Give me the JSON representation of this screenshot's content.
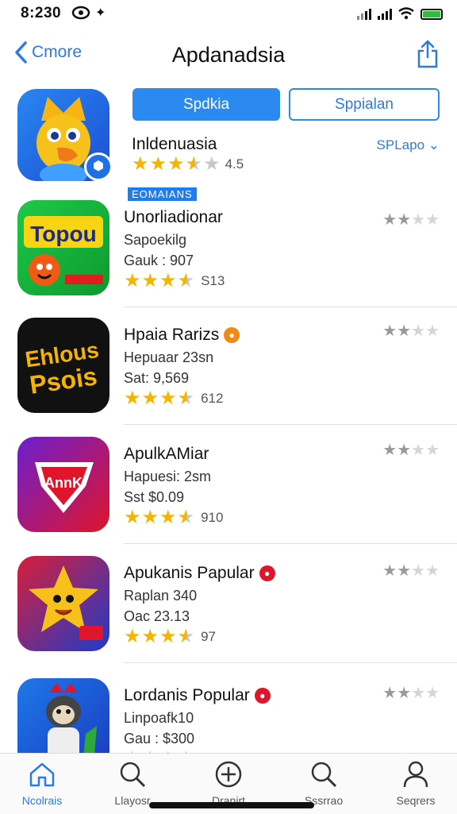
{
  "status": {
    "time": "8:230"
  },
  "nav": {
    "back_label": "Cmore",
    "title": "Apdanadsia"
  },
  "hero": {
    "primary_button": "Spdkia",
    "secondary_button": "Sppialan",
    "name": "Inldenuasia",
    "link": "SPLapo",
    "rating_value": "4.5",
    "section_tag": "EOMAIANS"
  },
  "apps": [
    {
      "name": "Unorliadionar",
      "sub1": "Sapoekilg",
      "sub2": "Gauk : 907",
      "rating_text": "S13",
      "icon_text": "Topou",
      "badge": ""
    },
    {
      "name": "Hpaia Rarizs",
      "sub1": "Hepuaar 23sn",
      "sub2": "Sat: 9,569",
      "rating_text": "612",
      "icon_text": "Ehlous Psois",
      "badge": "orange"
    },
    {
      "name": "ApulkAMiar",
      "sub1": "Hapuesi: 2sm",
      "sub2": "Sst $0.09",
      "rating_text": "910",
      "icon_text": "AnnK",
      "badge": ""
    },
    {
      "name": "Apukanis Papular",
      "sub1": "Raplan 340",
      "sub2": "Oac 23.13",
      "rating_text": "97",
      "icon_text": "",
      "badge": "red"
    },
    {
      "name": "Lordanis Popular",
      "sub1": "Linpoafk10",
      "sub2": "Gau : $300",
      "rating_text": "",
      "icon_text": "",
      "badge": "red"
    }
  ],
  "tabs": [
    {
      "label": "Ncolrais",
      "icon": "home-icon"
    },
    {
      "label": "Llayosr",
      "icon": "search-icon"
    },
    {
      "label": "Dranirt",
      "icon": "add-icon"
    },
    {
      "label": "Sssrrao",
      "icon": "search-icon"
    },
    {
      "label": "Seqrers",
      "icon": "person-icon"
    }
  ],
  "colors": {
    "accent": "#2a8af0",
    "star": "#f5b400"
  }
}
